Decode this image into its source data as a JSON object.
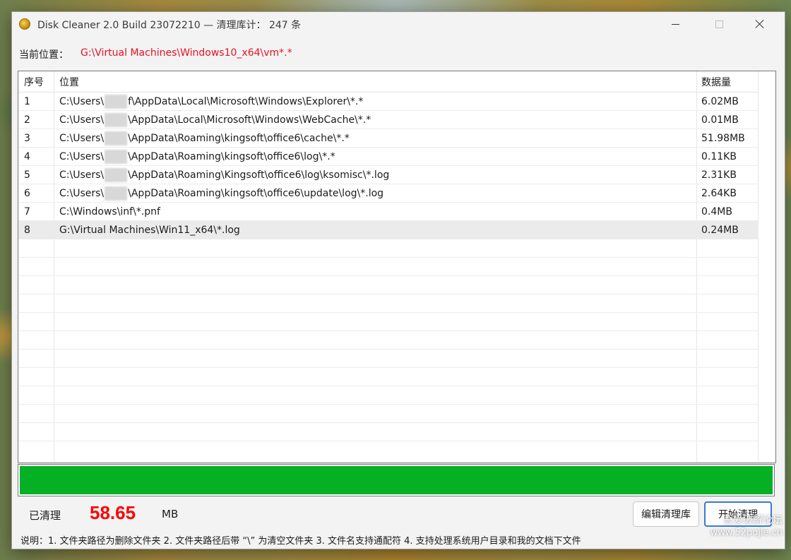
{
  "window": {
    "title": "Disk Cleaner 2.0 Build 23072210 — 清理库计： 247 条"
  },
  "location": {
    "label": "当前位置：",
    "value": "G:\\Virtual Machines\\Windows10_x64\\vm*.*"
  },
  "table": {
    "headers": [
      "序号",
      "位置",
      "数据量"
    ],
    "rows": [
      {
        "no": "1",
        "path_pre": "C:\\Users\\",
        "path_post": "f\\AppData\\Local\\Microsoft\\Windows\\Explorer\\*.*",
        "size": "6.02MB"
      },
      {
        "no": "2",
        "path_pre": "C:\\Users\\",
        "path_post": "\\AppData\\Local\\Microsoft\\Windows\\WebCache\\*.*",
        "size": "0.01MB"
      },
      {
        "no": "3",
        "path_pre": "C:\\Users\\",
        "path_post": "\\AppData\\Roaming\\kingsoft\\office6\\cache\\*.*",
        "size": "51.98MB"
      },
      {
        "no": "4",
        "path_pre": "C:\\Users\\",
        "path_post": "\\AppData\\Roaming\\kingsoft\\office6\\log\\*.*",
        "size": "0.11KB"
      },
      {
        "no": "5",
        "path_pre": "C:\\Users\\",
        "path_post": "\\AppData\\Roaming\\Kingsoft\\office6\\log\\ksomisc\\*.log",
        "size": "2.31KB"
      },
      {
        "no": "6",
        "path_pre": "C:\\Users\\",
        "path_post": "\\AppData\\Roaming\\kingsoft\\office6\\update\\log\\*.log",
        "size": "2.64KB"
      },
      {
        "no": "7",
        "path": "C:\\Windows\\inf\\*.pnf",
        "size": "0.4MB"
      },
      {
        "no": "8",
        "path": "G:\\Virtual Machines\\Win11_x64\\*.log",
        "size": "0.24MB"
      }
    ]
  },
  "progress": {
    "fraction": 1.0,
    "color": "#06b025"
  },
  "summary": {
    "cleaned_label": "已清理",
    "cleaned_value": "58.65",
    "cleaned_unit": "MB"
  },
  "buttons": {
    "edit_label": "编辑清理库",
    "start_label": "开始清理"
  },
  "note": "说明：1. 文件夹路径为删除文件夹  2. 文件夹路径后带 “\\” 为清空文件夹  3. 文件名支持通配符  4. 支持处理系统用户目录和我的文档下文件",
  "watermark": {
    "line1": "吾爱破解论坛",
    "line2": "www.52pojie.cn"
  },
  "colors": {
    "accent": "#3a7bd5",
    "location_text": "#e81123",
    "cleaned_value": "#ff0000"
  }
}
